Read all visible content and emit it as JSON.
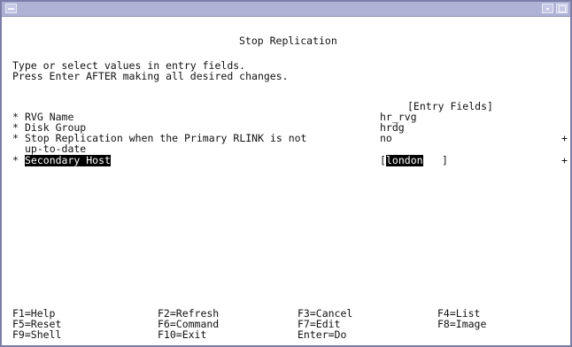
{
  "screen": {
    "title": "Stop Replication",
    "instructions": [
      "Type or select values in entry fields.",
      "Press Enter AFTER making all desired changes."
    ],
    "entry_fields_header": "[Entry Fields]",
    "fields": [
      {
        "marker": "*",
        "label": "RVG Name",
        "value": "hr_rvg",
        "suffix": ""
      },
      {
        "marker": "*",
        "label": "Disk Group",
        "value": "hrdg",
        "suffix": ""
      },
      {
        "marker": "*",
        "label": "Stop Replication when the Primary RLINK is not",
        "label2": "up-to-date",
        "value": "no",
        "suffix": "+"
      },
      {
        "marker": "*",
        "label": "Secondary Host",
        "value": "london",
        "suffix": "+"
      }
    ],
    "bracket_open": "[",
    "bracket_close": "]"
  },
  "function_keys": [
    [
      "F1=Help",
      "F2=Refresh",
      "F3=Cancel",
      "F4=List"
    ],
    [
      "F5=Reset",
      "F6=Command",
      "F7=Edit",
      "F8=Image"
    ],
    [
      "F9=Shell",
      "F10=Exit",
      "Enter=Do",
      ""
    ]
  ],
  "colors": {
    "titlebar": "#aeb3d6",
    "highlight_bg": "#000000",
    "highlight_fg": "#ffffff"
  }
}
